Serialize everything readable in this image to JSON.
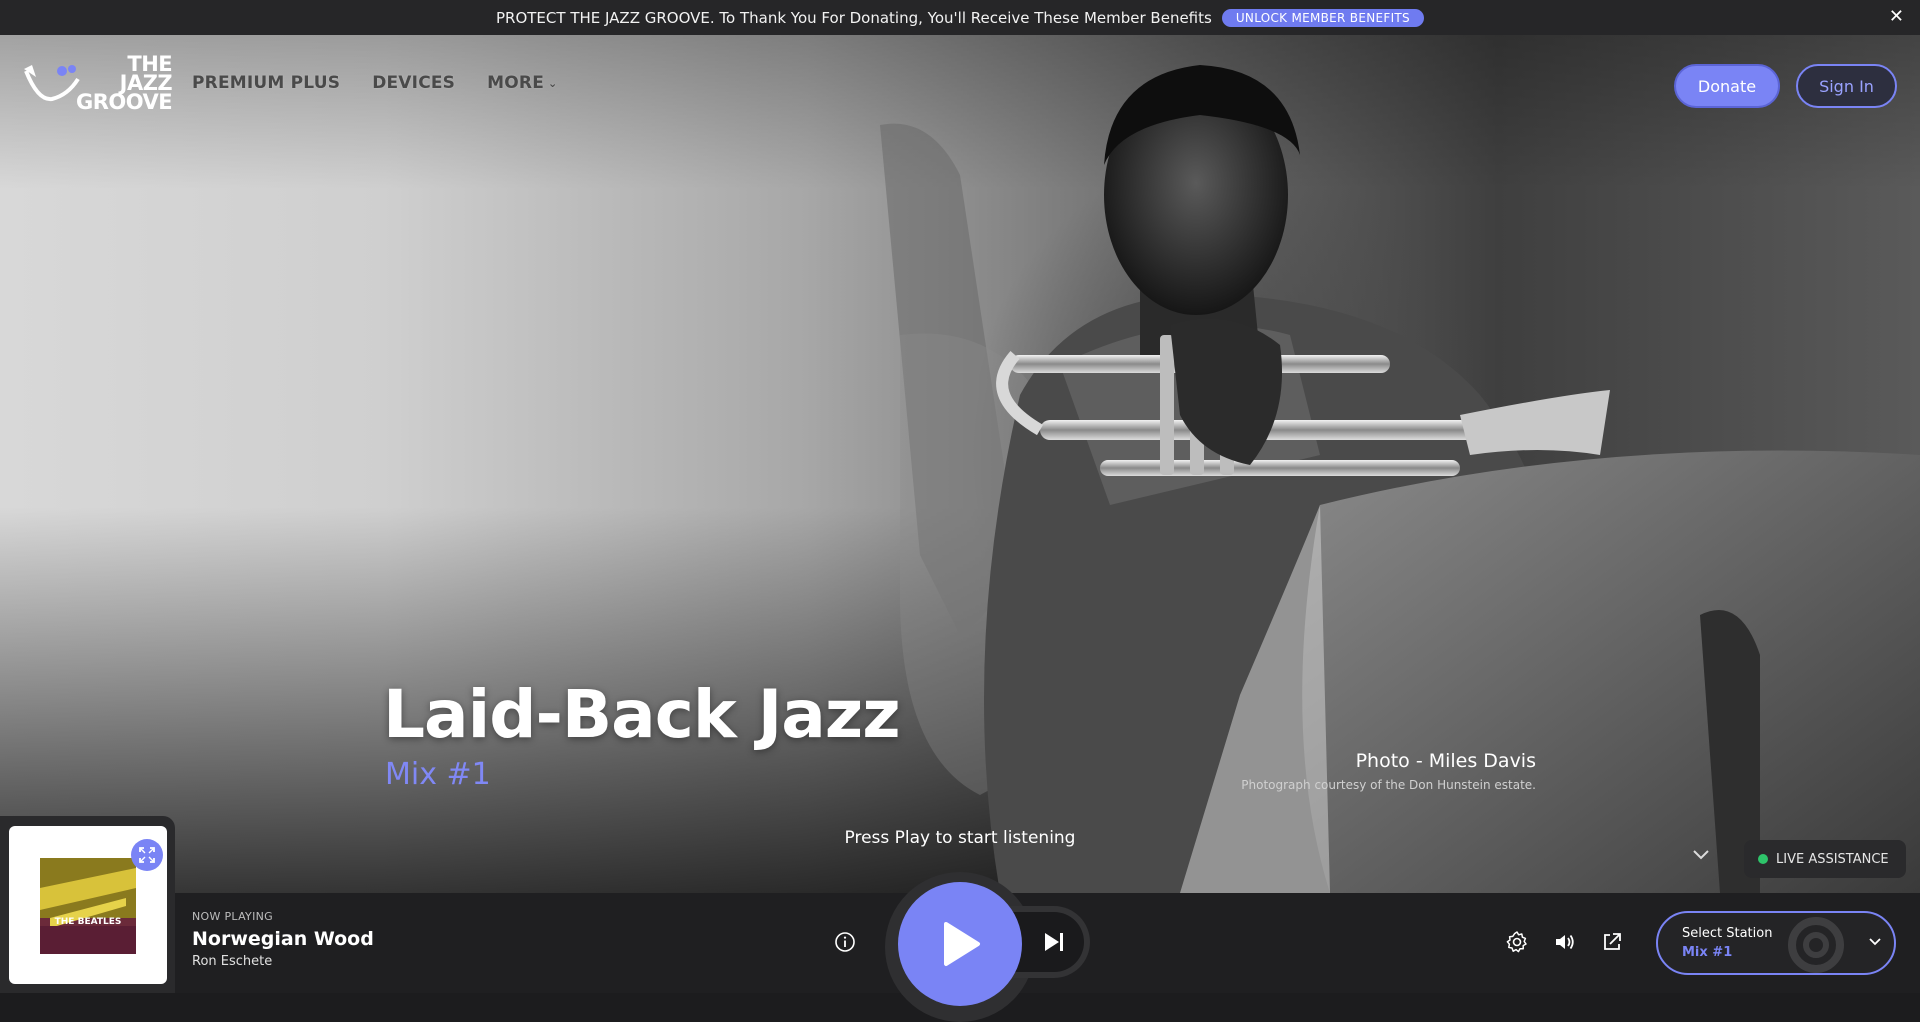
{
  "banner": {
    "message": "PROTECT THE JAZZ GROOVE. To Thank You For Donating, You'll Receive These Member Benefits",
    "cta": "UNLOCK MEMBER BENEFITS",
    "close": "✕"
  },
  "header": {
    "logo_lines": [
      "THE",
      "JAZZ",
      "GROOVE"
    ],
    "nav": [
      {
        "label": "PREMIUM PLUS"
      },
      {
        "label": "DEVICES"
      },
      {
        "label": "MORE",
        "has_dropdown": true
      }
    ],
    "donate_label": "Donate",
    "signin_label": "Sign In"
  },
  "hero": {
    "title": "Laid-Back Jazz",
    "subtitle": "Mix #1",
    "photo_credit_title": "Photo - Miles Davis",
    "photo_credit_note": "Photograph courtesy of the Don Hunstein estate.",
    "prompt": "Press Play to start listening"
  },
  "live_assistance": {
    "label": "LIVE ASSISTANCE",
    "status_color": "#2ec46a"
  },
  "player": {
    "now_playing_label": "NOW PLAYING",
    "track_title": "Norwegian Wood",
    "artist": "Ron Eschete",
    "album_art_text": "THE BEATLES",
    "station_label": "Select Station",
    "station_value": "Mix #1",
    "icons": [
      "info-icon",
      "play-icon",
      "skip-next-icon",
      "gear-icon",
      "volume-icon",
      "external-link-icon",
      "chevron-down-icon",
      "expand-icon"
    ]
  },
  "colors": {
    "accent": "#7a84f5",
    "banner_bg": "#262628",
    "player_bg": "#1f1f21"
  }
}
